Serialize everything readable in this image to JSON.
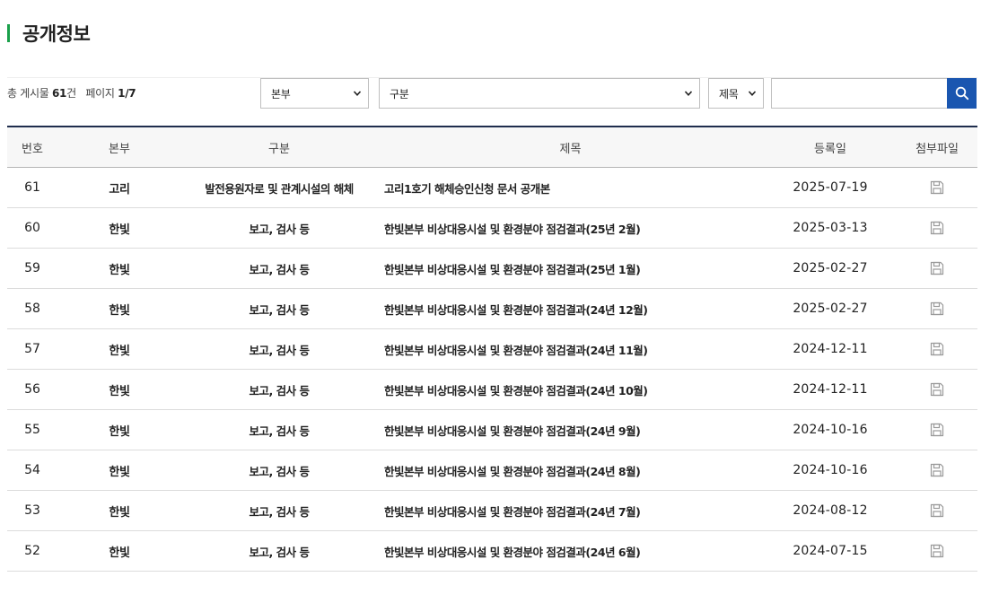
{
  "header": {
    "title": "공개정보"
  },
  "summary": {
    "total_prefix": "총 게시물",
    "total_count": "61",
    "total_suffix": "건",
    "page_label": "페이지",
    "page_value": "1/7"
  },
  "filters": {
    "division": "본부",
    "category": "구분",
    "search_field": "제목",
    "search_value": ""
  },
  "table": {
    "columns": [
      "번호",
      "본부",
      "구분",
      "제목",
      "등록일",
      "첨부파일"
    ],
    "rows": [
      {
        "no": "61",
        "division": "고리",
        "category": "발전용원자로 및 관계시설의 해체",
        "subject": "고리1호기 해체승인신청 문서 공개본",
        "date": "2025-07-19"
      },
      {
        "no": "60",
        "division": "한빛",
        "category": "보고, 검사 등",
        "subject": "한빛본부 비상대응시설 및 환경분야 점검결과(25년 2월)",
        "date": "2025-03-13"
      },
      {
        "no": "59",
        "division": "한빛",
        "category": "보고, 검사 등",
        "subject": "한빛본부 비상대응시설 및 환경분야 점검결과(25년 1월)",
        "date": "2025-02-27"
      },
      {
        "no": "58",
        "division": "한빛",
        "category": "보고, 검사 등",
        "subject": "한빛본부 비상대응시설 및 환경분야 점검결과(24년 12월)",
        "date": "2025-02-27"
      },
      {
        "no": "57",
        "division": "한빛",
        "category": "보고, 검사 등",
        "subject": "한빛본부 비상대응시설 및 환경분야 점검결과(24년 11월)",
        "date": "2024-12-11"
      },
      {
        "no": "56",
        "division": "한빛",
        "category": "보고, 검사 등",
        "subject": "한빛본부 비상대응시설 및 환경분야 점검결과(24년 10월)",
        "date": "2024-12-11"
      },
      {
        "no": "55",
        "division": "한빛",
        "category": "보고, 검사 등",
        "subject": "한빛본부 비상대응시설 및 환경분야 점검결과(24년 9월)",
        "date": "2024-10-16"
      },
      {
        "no": "54",
        "division": "한빛",
        "category": "보고, 검사 등",
        "subject": "한빛본부 비상대응시설 및 환경분야 점검결과(24년 8월)",
        "date": "2024-10-16"
      },
      {
        "no": "53",
        "division": "한빛",
        "category": "보고, 검사 등",
        "subject": "한빛본부 비상대응시설 및 환경분야 점검결과(24년 7월)",
        "date": "2024-08-12"
      },
      {
        "no": "52",
        "division": "한빛",
        "category": "보고, 검사 등",
        "subject": "한빛본부 비상대응시설 및 환경분야 점검결과(24년 6월)",
        "date": "2024-07-15"
      }
    ]
  },
  "icons": {
    "search": "search-icon",
    "attachment": "save-disk-icon",
    "dropdown": "chevron-down-icon"
  },
  "colors": {
    "accent_bar": "#1aa04b",
    "search_button": "#1a56b0",
    "table_top_border": "#1f2d4d"
  }
}
